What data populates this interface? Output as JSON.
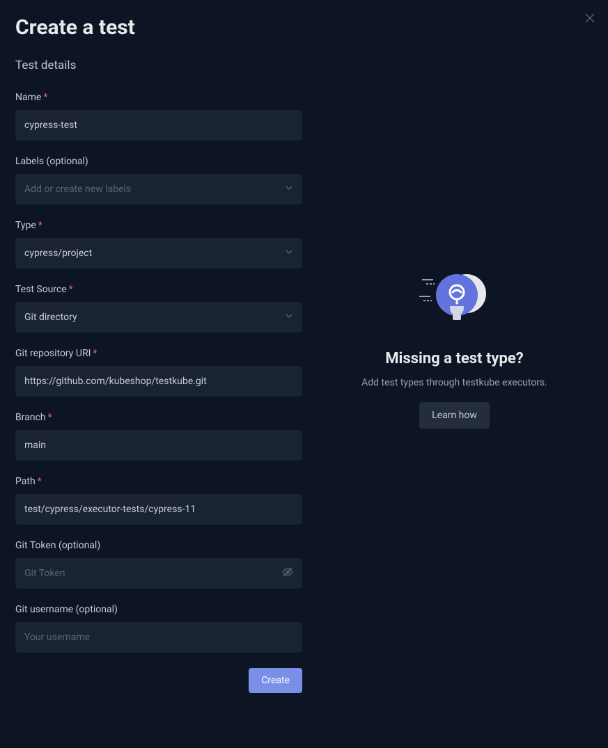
{
  "title": "Create a test",
  "section": "Test details",
  "close": "×",
  "fields": {
    "name": {
      "label": "Name",
      "value": "cypress-test",
      "required": true
    },
    "labels": {
      "label": "Labels (optional)",
      "placeholder": "Add or create new labels",
      "required": false
    },
    "type": {
      "label": "Type",
      "value": "cypress/project",
      "required": true
    },
    "testSource": {
      "label": "Test Source",
      "value": "Git directory",
      "required": true
    },
    "gitUri": {
      "label": "Git repository URI",
      "value": "https://github.com/kubeshop/testkube.git",
      "required": true
    },
    "branch": {
      "label": "Branch",
      "value": "main",
      "required": true
    },
    "path": {
      "label": "Path",
      "value": "test/cypress/executor-tests/cypress-11",
      "required": true
    },
    "gitToken": {
      "label": "Git Token (optional)",
      "placeholder": "Git Token",
      "required": false
    },
    "gitUsername": {
      "label": "Git username (optional)",
      "placeholder": "Your username",
      "required": false
    }
  },
  "createButton": "Create",
  "hint": {
    "title": "Missing a test type?",
    "text": "Add test types through testkube executors.",
    "button": "Learn how"
  },
  "colors": {
    "background": "#0d1423",
    "inputBg": "#1a2332",
    "primary": "#7b8fe8",
    "required": "#e36a6a"
  }
}
